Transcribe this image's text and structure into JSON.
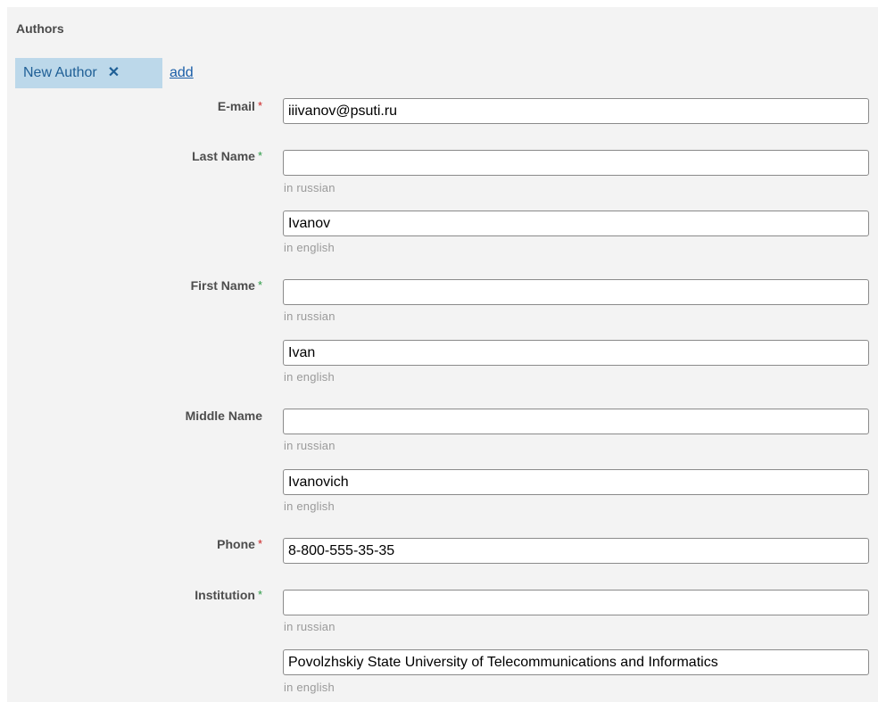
{
  "section": {
    "title": "Authors"
  },
  "tabs": [
    {
      "label": "New Author",
      "close_glyph": "✕"
    }
  ],
  "add_link": "add",
  "required_marker": "*",
  "fields": {
    "email": {
      "label": "E-mail",
      "value": "iiivanov@psuti.ru"
    },
    "last_name": {
      "label": "Last Name",
      "russian": {
        "value": "",
        "hint": "in russian"
      },
      "english": {
        "value": "Ivanov",
        "hint": "in english"
      }
    },
    "first_name": {
      "label": "First Name",
      "russian": {
        "value": "",
        "hint": "in russian"
      },
      "english": {
        "value": "Ivan",
        "hint": "in english"
      }
    },
    "middle_name": {
      "label": "Middle Name",
      "russian": {
        "value": "",
        "hint": "in russian"
      },
      "english": {
        "value": "Ivanovich",
        "hint": "in english"
      }
    },
    "phone": {
      "label": "Phone",
      "value": "8-800-555-35-35"
    },
    "institution": {
      "label": "Institution",
      "russian": {
        "value": "",
        "hint": "in russian"
      },
      "english": {
        "value": "Povolzhskiy State University of Telecommunications and Informatics",
        "hint": "in english"
      }
    }
  },
  "colors": {
    "tab_background": "#bcd8ea",
    "link": "#1a5ea8",
    "required_red": "#cc2222",
    "required_green": "#2a9a44",
    "panel_background": "#f3f3f3"
  }
}
